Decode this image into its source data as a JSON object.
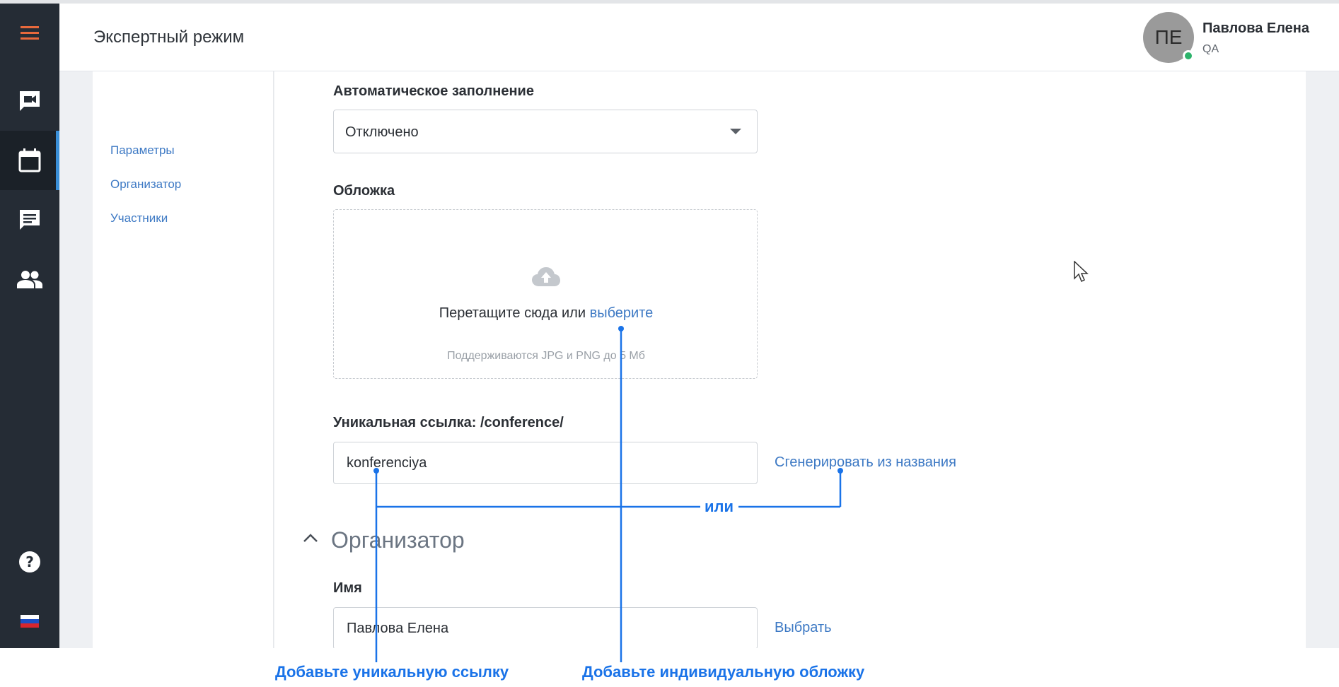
{
  "header": {
    "title": "Экспертный режим",
    "avatar_initials": "ПЕ",
    "user_name": "Павлова Елена",
    "user_role": "QA"
  },
  "sidebar": {
    "items": [
      {
        "icon": "menu-icon"
      },
      {
        "icon": "video-chat-icon"
      },
      {
        "icon": "calendar-icon",
        "active": true
      },
      {
        "icon": "message-icon"
      },
      {
        "icon": "people-icon"
      },
      {
        "icon": "help-icon"
      },
      {
        "icon": "russian-flag-icon"
      }
    ]
  },
  "toc": {
    "items": [
      "Параметры",
      "Организатор",
      "Участники"
    ]
  },
  "form": {
    "autofill_label": "Автоматическое заполнение",
    "autofill_value": "Отключено",
    "cover_label": "Обложка",
    "drop_text": "Перетащите сюда или",
    "drop_link": "выберите",
    "drop_hint": "Поддерживаются JPG и PNG до 5 Мб",
    "slug_label": "Уникальная ссылка: /conference/",
    "slug_value": "konferenciya",
    "generate_link": "Сгенерировать из названия",
    "organizer_section": "Организатор",
    "name_label": "Имя",
    "name_value": "Павлова Елена",
    "choose_link": "Выбрать"
  },
  "annotations": {
    "or": "или",
    "unique_link": "Добавьте уникальную ссылку",
    "custom_cover": "Добавьте индивидуальную обложку"
  },
  "colors": {
    "accent": "#3d79c4",
    "annotation": "#1a73e8",
    "sidebar": "#252c35",
    "menu": "#e8693c",
    "status_online": "#2db36b"
  }
}
